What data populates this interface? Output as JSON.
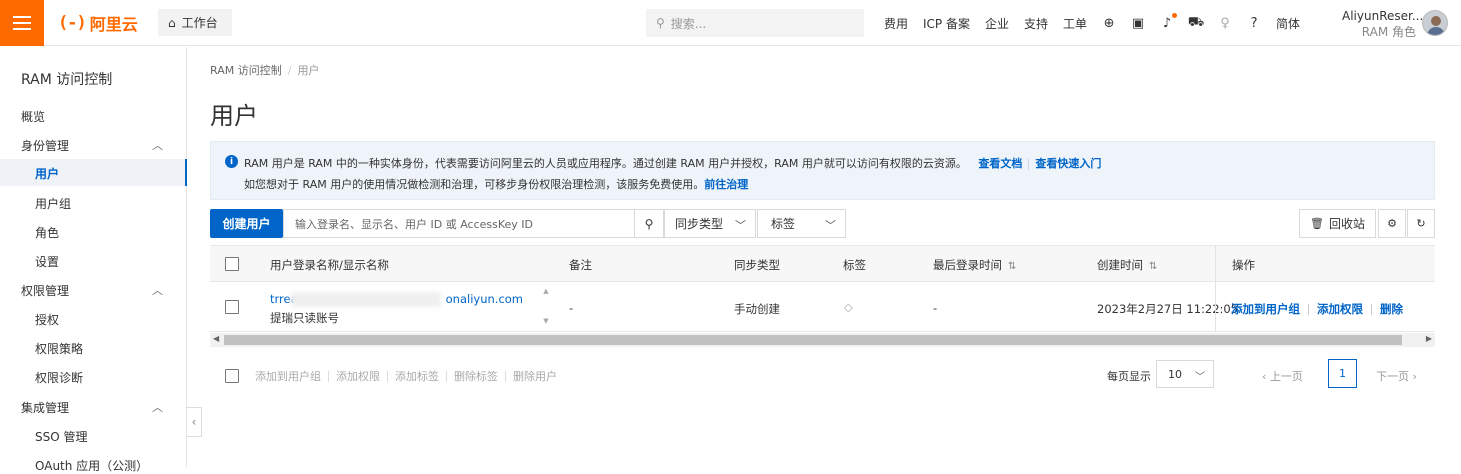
{
  "header": {
    "brand": "阿里云",
    "brand_mark": "(-)",
    "workbench": "工作台",
    "search_placeholder": "搜索...",
    "nav": [
      "费用",
      "ICP 备案",
      "企业",
      "支持",
      "工单"
    ],
    "lang": "简体",
    "user_name": "AliyunReser...",
    "user_role": "RAM 角色",
    "accent": "#ff6a00"
  },
  "sidebar": {
    "title": "RAM 访问控制",
    "overview": "概览",
    "groups": [
      {
        "label": "身份管理",
        "items": [
          "用户",
          "用户组",
          "角色",
          "设置"
        ]
      },
      {
        "label": "权限管理",
        "items": [
          "授权",
          "权限策略",
          "权限诊断"
        ]
      },
      {
        "label": "集成管理",
        "items": [
          "SSO 管理",
          "OAuth 应用（公测）"
        ]
      }
    ],
    "active": "用户"
  },
  "breadcrumb": {
    "root": "RAM 访问控制",
    "current": "用户"
  },
  "page_title": "用户",
  "info": {
    "line1": "RAM 用户是 RAM 中的一种实体身份，代表需要访问阿里云的人员或应用程序。通过创建 RAM 用户并授权，RAM 用户就可以访问有权限的云资源。",
    "link_docs": "查看文档",
    "link_quick": "查看快速入门",
    "line2": "如您想对于 RAM 用户的使用情况做检测和治理，可移步身份权限治理检测，该服务免费使用。",
    "link_gov": "前往治理"
  },
  "toolbar": {
    "create": "创建用户",
    "search_placeholder": "输入登录名、显示名、用户 ID 或 AccessKey ID",
    "sync_type": "同步类型",
    "tags": "标签",
    "recycle": "回收站"
  },
  "table": {
    "columns": [
      "用户登录名称/显示名称",
      "备注",
      "同步类型",
      "标签",
      "最后登录时间",
      "创建时间",
      "操作"
    ],
    "rows": [
      {
        "login_prefix": "trrea",
        "login_suffix": "onaliyun.com",
        "display": "提瑞只读账号",
        "note": "-",
        "sync": "手动创建",
        "last_login": "-",
        "created": "2023年2月27日 11:22:05",
        "actions": [
          "添加到用户组",
          "添加权限",
          "删除"
        ]
      }
    ]
  },
  "bulk": [
    "添加到用户组",
    "添加权限",
    "添加标签",
    "删除标签",
    "删除用户"
  ],
  "pagination": {
    "per_page_label": "每页显示",
    "per_page": "10",
    "prev": "上一页",
    "page": "1",
    "next": "下一页"
  }
}
